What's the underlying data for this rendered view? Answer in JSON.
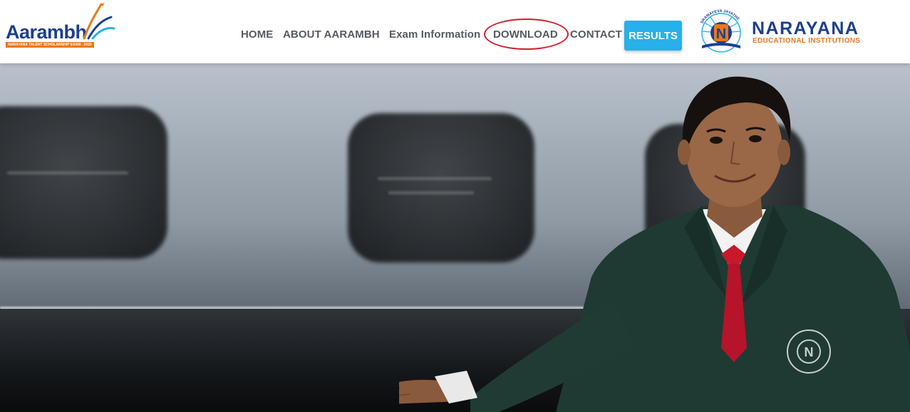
{
  "header": {
    "left_logo": {
      "word": "Aarambh",
      "tagline": "NARAYANA TALENT SCHOLARSHIP EXAM - 2020"
    },
    "nav": {
      "home": "HOME",
      "about": "ABOUT AARAMBH",
      "exam_info": "Exam Information",
      "download": "DOWNLOAD",
      "contact": "CONTACT",
      "results": "RESULTS"
    },
    "right_logo": {
      "name": "NARAYANA",
      "subtitle": "EDUCATIONAL INSTITUTIONS",
      "arc_text": "SRAMAYEVA JAYATHE",
      "letter": "N"
    }
  },
  "hero": {
    "description_icon": "student-photo"
  },
  "colors": {
    "brand_blue": "#1c3f8f",
    "brand_orange": "#e8791e",
    "results_button": "#27b0ea",
    "highlight_ring": "#d21f2a",
    "nav_text": "#555b63"
  }
}
